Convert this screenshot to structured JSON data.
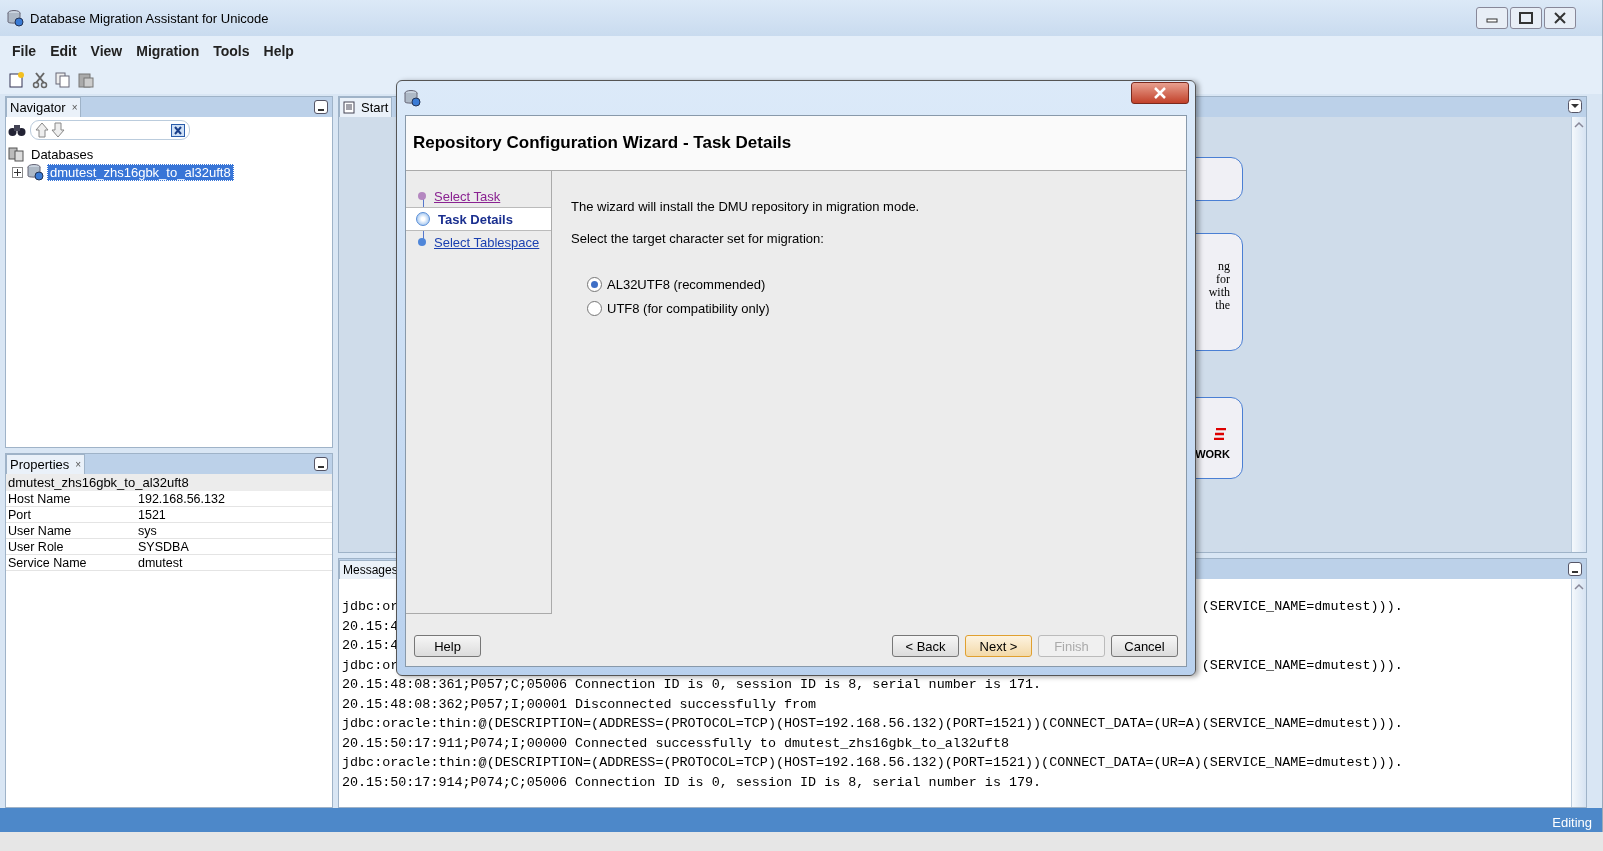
{
  "window": {
    "title": "Database Migration Assistant for Unicode"
  },
  "menu": [
    {
      "label": "File"
    },
    {
      "label": "Edit"
    },
    {
      "label": "View"
    },
    {
      "label": "Migration"
    },
    {
      "label": "Tools"
    },
    {
      "label": "Help"
    }
  ],
  "navigator": {
    "tab": "Navigator",
    "tab_close": "×",
    "tree": [
      {
        "label": "Databases",
        "selected": false,
        "children": [
          {
            "label": "dmutest_zhs16gbk_to_al32uft8",
            "selected": true
          }
        ]
      }
    ]
  },
  "properties": {
    "tab": "Properties",
    "tab_close": "×",
    "header": "dmutest_zhs16gbk_to_al32uft8",
    "rows": [
      {
        "name": "Host Name",
        "value": "192.168.56.132"
      },
      {
        "name": "Port",
        "value": "1521"
      },
      {
        "name": "User Name",
        "value": "sys"
      },
      {
        "name": "User Role",
        "value": "SYSDBA"
      },
      {
        "name": "Service Name",
        "value": "dmutest"
      }
    ]
  },
  "start_page": {
    "tab": "Start",
    "cards": [
      {
        "kind": "blank"
      },
      {
        "kind": "text",
        "lines": [
          "ng",
          "for",
          "with",
          "the"
        ]
      },
      {
        "kind": "logo",
        "lines": [
          "WORK"
        ]
      }
    ]
  },
  "messages": {
    "tab": "Messages",
    "lines": [
      {
        "left": "jdbc:or",
        "right": "(SERVICE_NAME=dmutest)))."
      },
      {
        "left": "20.15:4"
      },
      {
        "left": "20.15:4"
      },
      {
        "left": "jdbc:or",
        "right": "(SERVICE_NAME=dmutest)))."
      },
      {
        "left": "20.15:48:08:361;P057;C;05006 Connection ID is 0, session ID is 8, serial number is 171."
      },
      {
        "left": "20.15:48:08:362;P057;I;00001 Disconnected successfully from"
      },
      {
        "left": "jdbc:oracle:thin:@(DESCRIPTION=(ADDRESS=(PROTOCOL=TCP)(HOST=192.168.56.132)(PORT=1521))(CONNECT_DATA=(UR=A)(SERVICE_NAME=dmutest)))."
      },
      {
        "left": "20.15:50:17:911;P074;I;00000 Connected successfully to dmutest_zhs16gbk_to_al32uft8"
      },
      {
        "left": "jdbc:oracle:thin:@(DESCRIPTION=(ADDRESS=(PROTOCOL=TCP)(HOST=192.168.56.132)(PORT=1521))(CONNECT_DATA=(UR=A)(SERVICE_NAME=dmutest)))."
      },
      {
        "left": "20.15:50:17:914;P074;C;05006 Connection ID is 0, session ID is 8, serial number is 179."
      }
    ]
  },
  "dialog": {
    "heading": "Repository Configuration Wizard - Task Details",
    "steps": [
      {
        "label": "Select Task",
        "selected": false,
        "visited": true
      },
      {
        "label": "Task Details",
        "selected": true,
        "visited": false
      },
      {
        "label": "Select Tablespace",
        "selected": false,
        "visited": false
      }
    ],
    "intro": "The wizard will install the DMU repository in migration mode.",
    "prompt": "Select the target character set for migration:",
    "options": [
      {
        "label": "AL32UTF8 (recommended)",
        "selected": true
      },
      {
        "label": "UTF8 (for compatibility only)",
        "selected": false
      }
    ],
    "buttons": [
      {
        "label": "Help",
        "kind": "help",
        "default": false,
        "disabled": false
      },
      {
        "label": "< Back",
        "kind": "nav",
        "default": false,
        "disabled": false
      },
      {
        "label": "Next >",
        "kind": "nav",
        "default": true,
        "disabled": false
      },
      {
        "label": "Finish",
        "kind": "nav",
        "default": false,
        "disabled": true
      },
      {
        "label": "Cancel",
        "kind": "nav",
        "default": false,
        "disabled": false
      }
    ]
  },
  "status_bar": {
    "text": "Editing"
  }
}
